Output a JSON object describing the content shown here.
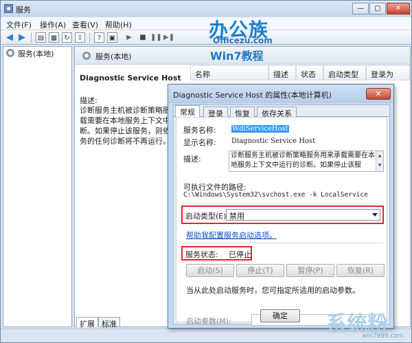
{
  "window": {
    "title": "服务",
    "controls": {
      "minimize": "—",
      "maximize": "▢",
      "close": "✕"
    }
  },
  "menu": [
    "文件(F)",
    "操作(A)",
    "查看(V)",
    "帮助(H)"
  ],
  "tree": {
    "root": "服务(本地)"
  },
  "pane": {
    "header": "服务(本地)",
    "service_name": "Diagnostic Service Host",
    "desc_label": "描述:",
    "desc_lines": [
      "诊断服务主机被诊断策略服务",
      "载需要在本地服务上下文中运",
      "断。如果停止该服务，则依赖",
      "务的任何诊断将不再运行。"
    ],
    "columns": [
      "名称",
      "描述",
      "状态",
      "启动类型",
      "登录为"
    ],
    "tabs": [
      "扩展",
      "标准"
    ]
  },
  "watermark": {
    "brand": "办公族",
    "site": "Officezu.com",
    "win7": "Win7教程",
    "corner_text": "系统粉",
    "corner_url": "win7999.com"
  },
  "dialog": {
    "title": "Diagnostic Service Host 的属性(本地计算机)",
    "close": "✕",
    "tabs": [
      "常规",
      "登录",
      "恢复",
      "依存关系"
    ],
    "service_name_label": "服务名称:",
    "service_name": "WdiServiceHost",
    "display_name_label": "显示名称:",
    "display_name": "Diagnostic Service Host",
    "description_label": "描述:",
    "description": "诊断服务主机被诊断策略服务用来承载需要在本地服务上下文中运行的诊断。如果停止该服",
    "path_label": "可执行文件的路径:",
    "path": "C:\\Windows\\System32\\svchost.exe -k LocalService",
    "startup_type_label": "启动类型(E):",
    "startup_type": "禁用",
    "help_link": "帮助我配置服务启动选项。",
    "status_label": "服务状态:",
    "status": "已停止",
    "buttons": {
      "start": "启动(S)",
      "stop": "停止(T)",
      "pause": "暂停(P)",
      "resume": "恢复(R)"
    },
    "start_hint": "当从此处启动服务时，您可指定所适用的启动参数。",
    "start_params_label": "启动参数(M):",
    "ok": "确定"
  }
}
